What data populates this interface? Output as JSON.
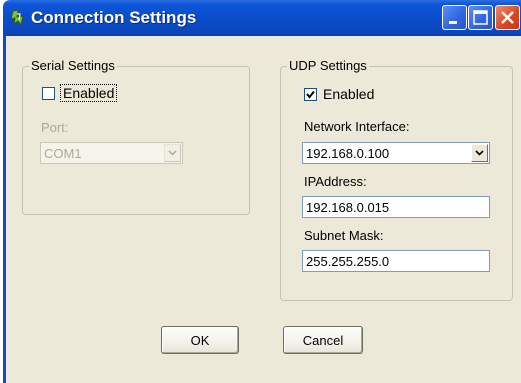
{
  "window": {
    "title": "Connection Settings",
    "icon": "app-icon",
    "controls": [
      "minimize-icon",
      "maximize-icon",
      "close-icon"
    ],
    "colors": {
      "titlebar": "#0a4ccb",
      "client": "#ece9d8",
      "close": "#d8461e"
    }
  },
  "serial": {
    "legend": "Serial Settings",
    "enabled_label": "Enabled",
    "enabled_checked": false,
    "port_label": "Port:",
    "port_value": "COM1",
    "port_disabled": true
  },
  "udp": {
    "legend": "UDP Settings",
    "enabled_label": "Enabled",
    "enabled_checked": true,
    "network_interface_label": "Network Interface:",
    "network_interface_value": "192.168.0.100",
    "ip_address_label": "IPAddress:",
    "ip_address_value": "192.168.0.015",
    "subnet_mask_label": "Subnet Mask:",
    "subnet_mask_value": "255.255.255.0"
  },
  "buttons": {
    "ok_label": "OK",
    "cancel_label": "Cancel"
  }
}
